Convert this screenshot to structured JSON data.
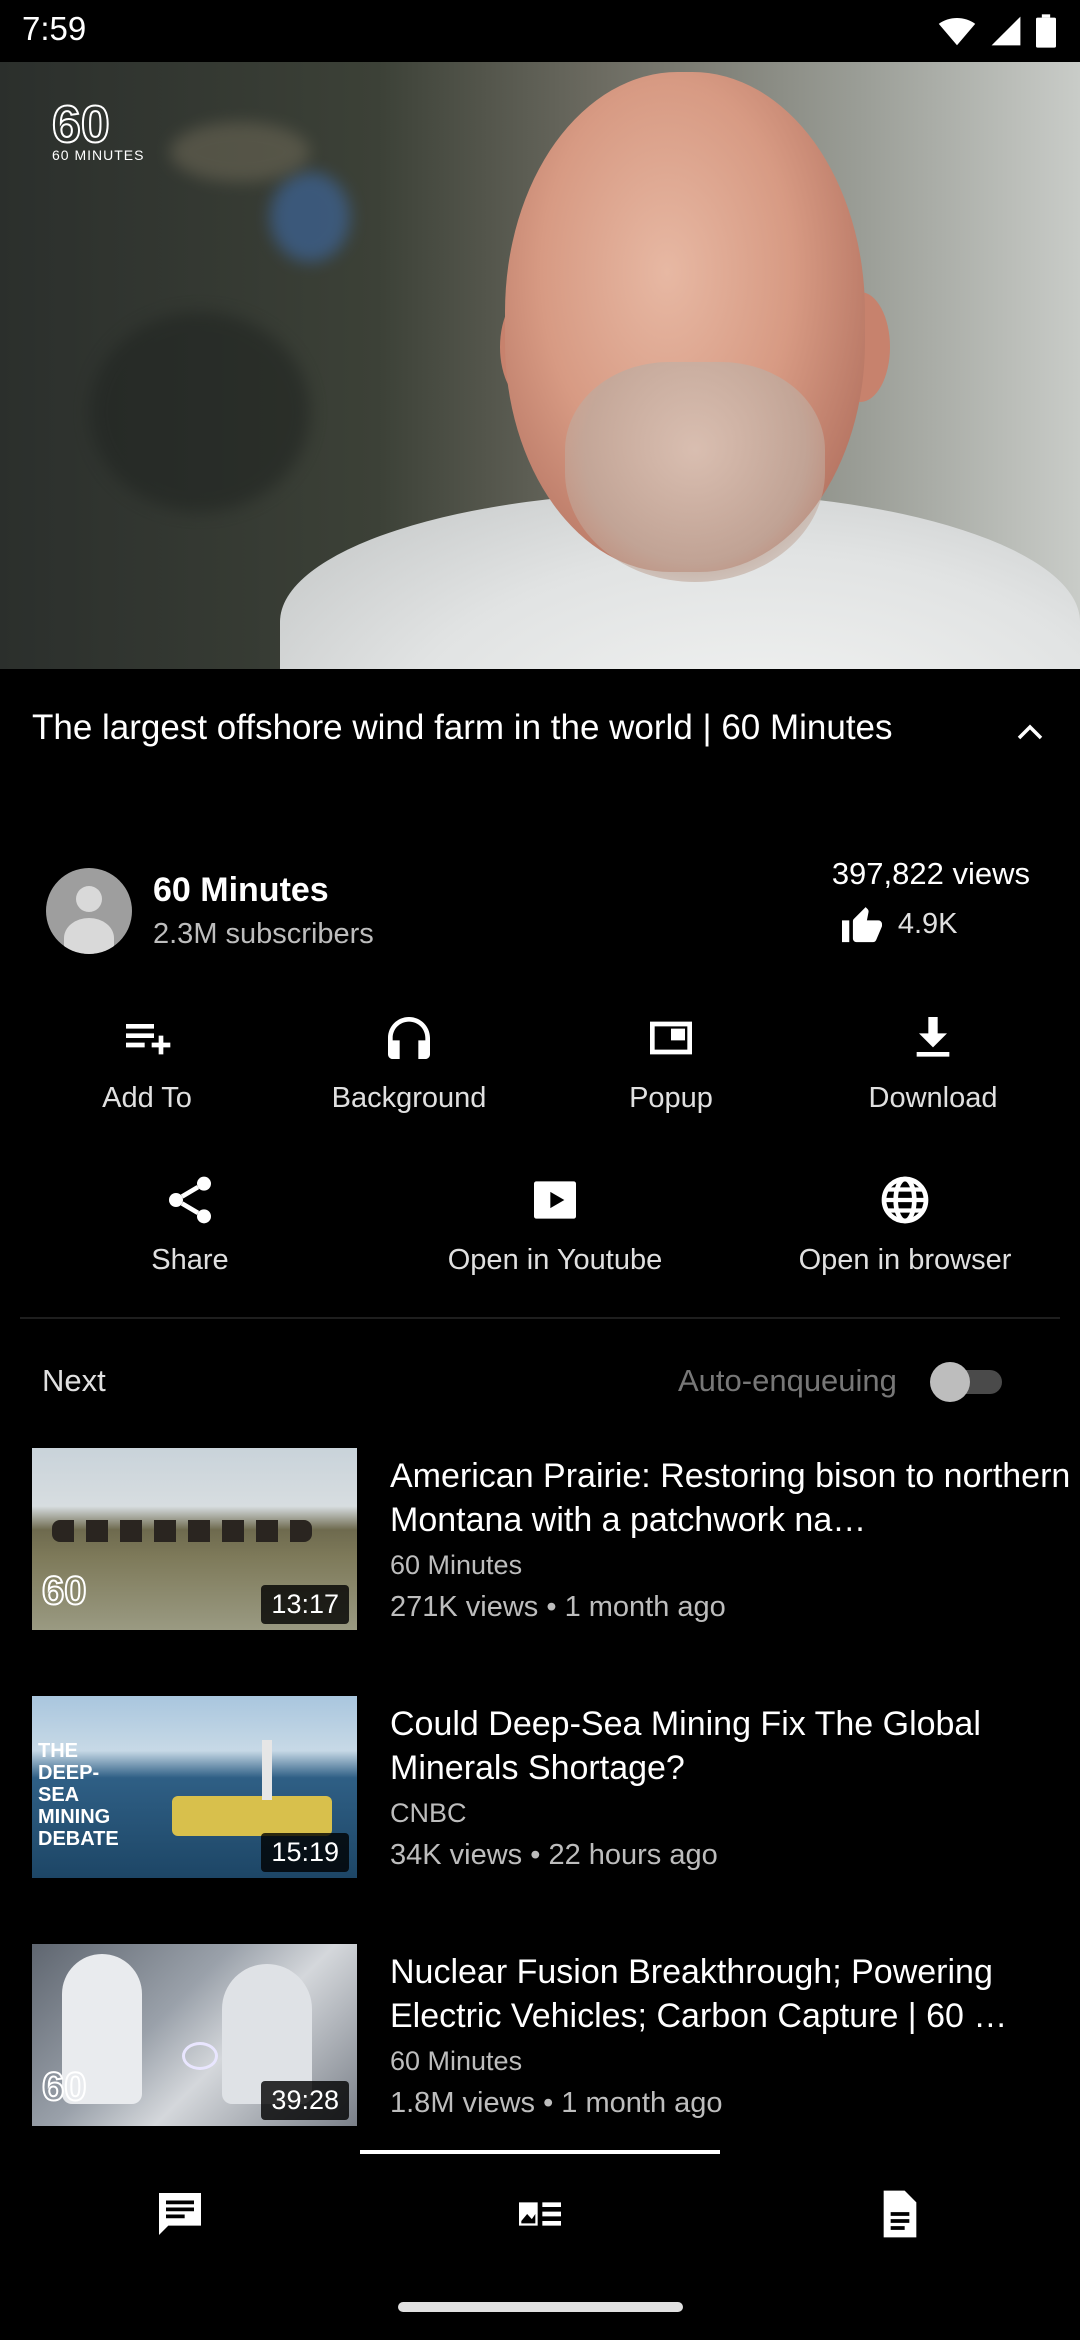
{
  "status": {
    "time": "7:59",
    "icons": [
      "wifi-icon",
      "signal-icon",
      "battery-icon"
    ]
  },
  "video": {
    "logo_text": "60 MINUTES"
  },
  "title": "The largest offshore wind farm in the world | 60 Minutes",
  "channel": {
    "name": "60 Minutes",
    "subscribers": "2.3M subscribers"
  },
  "stats": {
    "views": "397,822 views",
    "likes": "4.9K"
  },
  "actions": [
    {
      "label": "Add To",
      "icon": "playlist-add-icon"
    },
    {
      "label": "Background",
      "icon": "headphones-icon"
    },
    {
      "label": "Popup",
      "icon": "popup-icon"
    },
    {
      "label": "Download",
      "icon": "download-icon"
    },
    {
      "label": "Share",
      "icon": "share-icon"
    },
    {
      "label": "Open in Youtube",
      "icon": "youtube-icon"
    },
    {
      "label": "Open in browser",
      "icon": "globe-icon"
    }
  ],
  "next": {
    "label": "Next",
    "auto_label": "Auto-enqueuing",
    "auto_enabled": false
  },
  "related": [
    {
      "title": "American Prairie: Restoring bison to northern Montana with a patchwork na…",
      "channel": "60 Minutes",
      "meta": "271K views • 1 month ago",
      "duration": "13:17"
    },
    {
      "title": "Could Deep-Sea Mining Fix The Global Minerals Shortage?",
      "channel": "CNBC",
      "meta": "34K views • 22 hours ago",
      "duration": "15:19",
      "thumb_text": "THE DEEP-SEA MINING DEBATE"
    },
    {
      "title": "Nuclear Fusion Breakthrough; Powering Electric Vehicles; Carbon Capture | 60 …",
      "channel": "60 Minutes",
      "meta": "1.8M views • 1 month ago",
      "duration": "39:28"
    }
  ],
  "tabs": [
    "comments-icon",
    "related-items-icon",
    "description-icon"
  ]
}
